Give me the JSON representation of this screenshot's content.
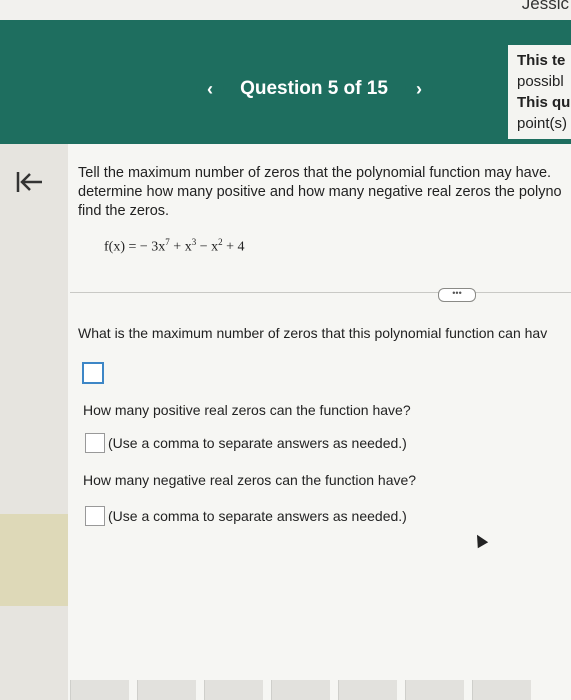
{
  "user": {
    "name": "Jessic"
  },
  "header": {
    "question_label": "Question 5 of 15",
    "prev_symbol": "‹",
    "next_symbol": "›",
    "notice_lines": [
      "This te",
      "possibl",
      "This qu",
      "point(s)"
    ]
  },
  "question": {
    "prompt_lines": [
      "Tell the maximum number of zeros that the polynomial function may have.",
      "determine how many positive and how many negative real zeros the polyno",
      "find the zeros."
    ],
    "formula": {
      "lhs": "f(x) = ",
      "t1": "− 3x",
      "e1": "7",
      "t2": " + x",
      "e2": "3",
      "t3": " − x",
      "e3": "2",
      "t4": " + 4"
    },
    "more_label": "•••",
    "parts": [
      {
        "text": "What is the maximum number of zeros that this polynomial function can hav"
      },
      {
        "text": "How many positive real zeros can the function have?",
        "hint": "(Use a comma to separate answers as needed.)"
      },
      {
        "text": "How many negative real zeros can the function have?",
        "hint": "(Use a comma to separate answers as needed.)"
      }
    ]
  },
  "colors": {
    "header_bg": "#1e6e5f",
    "content_bg": "#f6f6f3",
    "focus_border": "#3d86c6"
  },
  "icons": {
    "back": "collapse-left-icon"
  }
}
